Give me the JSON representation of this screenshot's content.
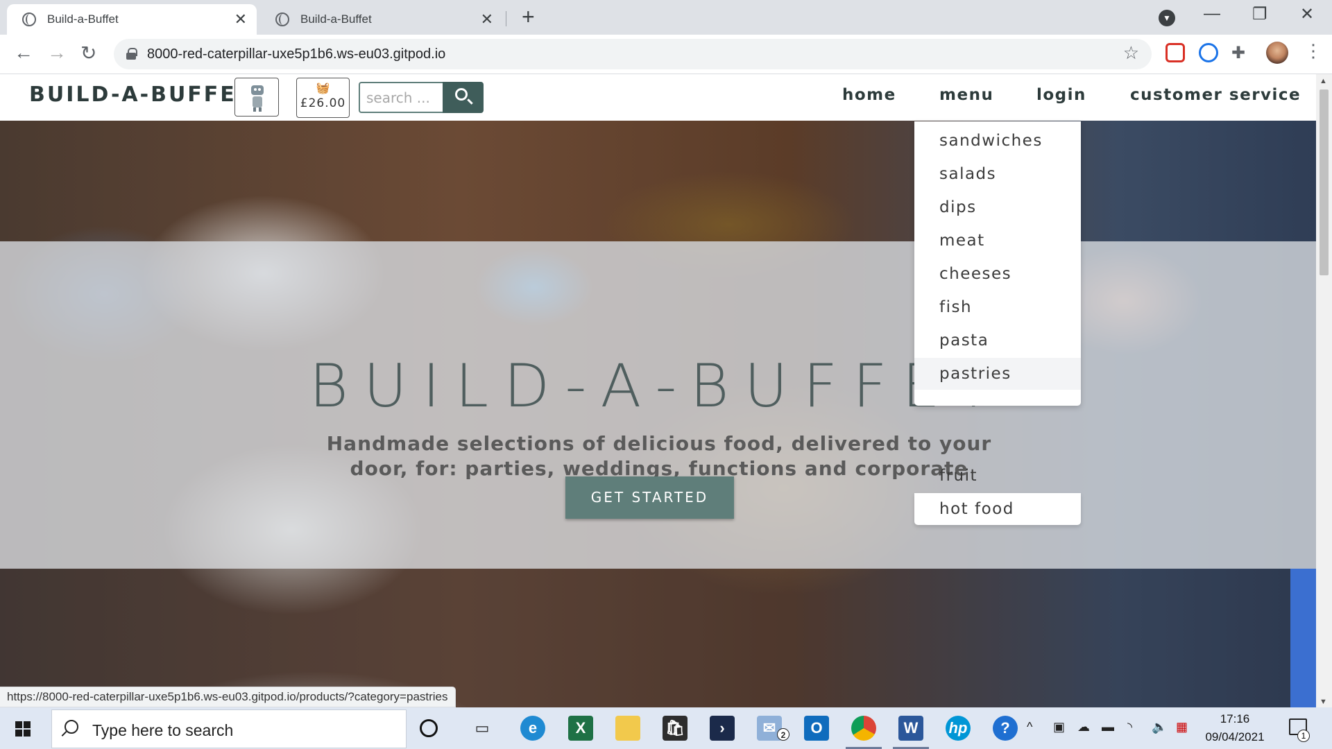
{
  "browser": {
    "tabs": [
      {
        "title": "Build-a-Buffet",
        "active": true
      },
      {
        "title": "Build-a-Buffet",
        "active": false
      }
    ],
    "url": "8000-red-caterpillar-uxe5p1b6.ws-eu03.gitpod.io",
    "status_url": "https://8000-red-caterpillar-uxe5p1b6.ws-eu03.gitpod.io/products/?category=pastries"
  },
  "site": {
    "brand": "BUILD-A-BUFFET",
    "basket_total": "£26.00",
    "search_placeholder": "search ...",
    "nav": {
      "home": "home",
      "menu": "menu",
      "login": "login",
      "customer_service": "customer service"
    },
    "menu_items": [
      "sandwiches",
      "salads",
      "dips",
      "meat",
      "cheeses",
      "fish",
      "pasta",
      "pastries",
      "fruit",
      "hot food"
    ],
    "hovered_item": "pastries"
  },
  "hero": {
    "title": "BUILD-A-BUFFET",
    "subtitle": "Handmade selections of delicious food, delivered to your door, for: parties, weddings, functions and corporate events.",
    "cta": "GET STARTED"
  },
  "taskbar": {
    "search_placeholder": "Type here to search",
    "time": "17:16",
    "date": "09/04/2021",
    "mail_badge": "2",
    "notification_badge": "1"
  },
  "colors": {
    "accent": "#5f7e7a",
    "search_button": "#3f5d5a",
    "heading": "#4f5e5e"
  }
}
